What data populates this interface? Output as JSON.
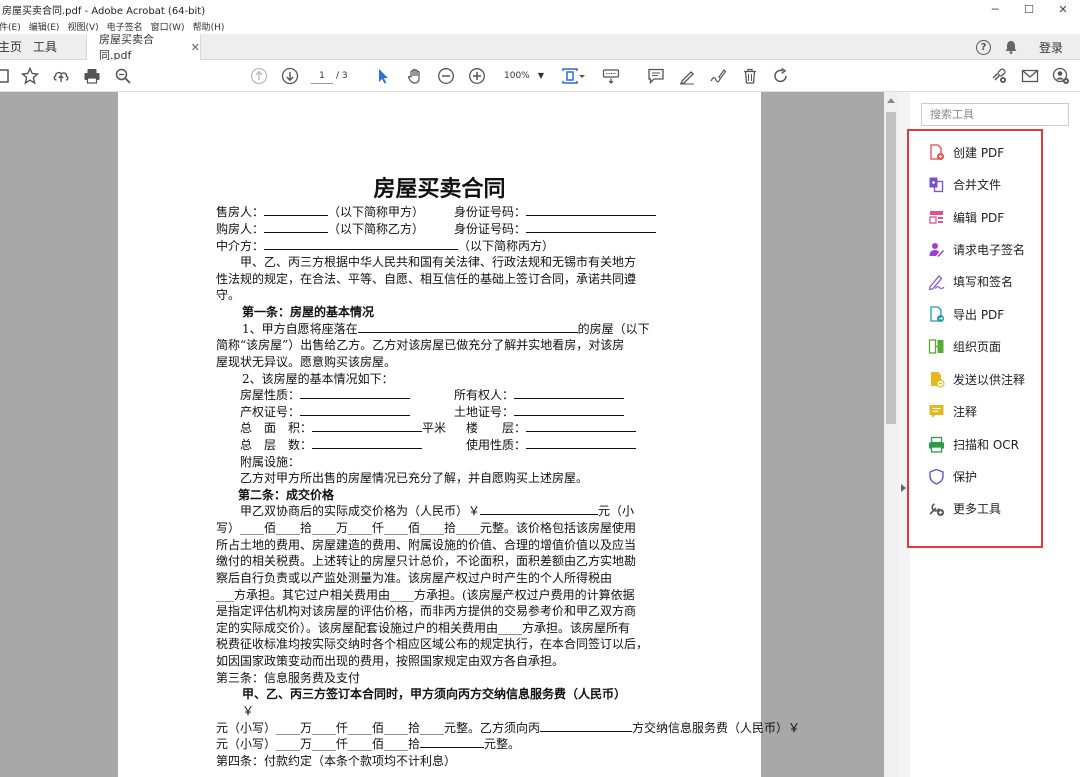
{
  "window": {
    "title": "房屋买卖合同.pdf - Adobe Acrobat (64-bit)",
    "min": "─",
    "max": "☐",
    "close": "✕"
  },
  "menu": [
    "件(E)",
    "编辑(E)",
    "视图(V)",
    "电子签名",
    "窗口(W)",
    "帮助(H)"
  ],
  "tabs": {
    "home": "主页",
    "tools": "工具",
    "doc": "房屋买卖合同.pdf",
    "login": "登录"
  },
  "toolbar": {
    "page_current": "1",
    "page_total": "/ 3",
    "zoom": "100%"
  },
  "document": {
    "title": "房屋买卖合同",
    "lines": [
      "售房人：",
      "（以下简称甲方）",
      "身份证号码：",
      "购房人：",
      "（以下简称乙方）",
      "身份证号码：",
      "中介方：",
      "（以下简称丙方）",
      "甲、乙、丙三方根据中华人民共和国有关法律、行政法规和无锡市有关地方",
      "性法规的规定，在合法、平等、自愿、相互信任的基础上签订合同，承诺共同遵",
      "守。",
      "第一条：房屋的基本情况",
      "1、甲方自愿将座落在",
      "的房屋（以下",
      "简称“该房屋”）出售给乙方。乙方对该房屋已做充分了解并实地看房，对该房",
      "屋现状无异议。愿意购买该房屋。",
      "2、该房屋的基本情况如下：",
      "房屋性质：",
      "所有权人：",
      "产权证号：",
      "土地证号：",
      "总　面　积：",
      "平米",
      "楼　　层：",
      "总　层　数：",
      "使用性质：",
      "附属设施：",
      "乙方对甲方所出售的房屋情况已充分了解，并自愿购买上述房屋。",
      "第二条：成交价格",
      "甲乙双协商后的实际成交价格为（人民币）￥",
      "元（小",
      "写）____佰____拾____万____仟____佰____拾____元整。该价格包括该房屋使用",
      "所占土地的费用、房屋建造的费用、附属设施的价值、合理的增值价值以及应当",
      "缴付的相关税费。上述转让的房屋只计总价，不论面积，面积差额由乙方实地勘",
      "察后自行负责或以产监处测量为准。该房屋产权过户时产生的个人所得税由",
      "___方承担。其它过户相关费用由____方承担。(该房屋产权过户费用的计算依据",
      "是指定评估机构对该房屋的评估价格，而非丙方提供的交易参考价和甲乙双方商",
      "定的实际成交价）。该房屋配套设施过户的相关费用由____方承担。该房屋所有",
      "税费征收标准均按实际交纳时各个相应区域公布的规定执行，在本合同签订以后，",
      "如因国家政策变动而出现的费用，按照国家规定由双方各自承担。",
      "第三条：信息服务费及支付",
      "甲、乙、丙三方签订本合同时，甲方须向丙方交纳信息服务费（人民币）",
      "￥",
      "元（小写）____万____仟____佰____拾____元整。乙方须向丙",
      "方交纳信息服务费（人民币）￥",
      "元（小写）____万____仟____佰____拾",
      "元整。",
      "第四条：付款约定（本条个款项均不计利息）"
    ]
  },
  "panel": {
    "search_placeholder": "搜索工具",
    "tools": [
      {
        "label": "创建 PDF",
        "icon": "create-pdf-icon",
        "color": "#e34850"
      },
      {
        "label": "合并文件",
        "icon": "combine-files-icon",
        "color": "#7a4fd6"
      },
      {
        "label": "编辑 PDF",
        "icon": "edit-pdf-icon",
        "color": "#e34f8d"
      },
      {
        "label": "请求电子签名",
        "icon": "request-signature-icon",
        "color": "#9f3fd0"
      },
      {
        "label": "填写和签名",
        "icon": "fill-sign-icon",
        "color": "#8a5bd6"
      },
      {
        "label": "导出 PDF",
        "icon": "export-pdf-icon",
        "color": "#1f9aa7"
      },
      {
        "label": "组织页面",
        "icon": "organize-pages-icon",
        "color": "#5aa83a"
      },
      {
        "label": "发送以供注释",
        "icon": "send-comments-icon",
        "color": "#e6b81e"
      },
      {
        "label": "注释",
        "icon": "comment-icon",
        "color": "#e6b81e"
      },
      {
        "label": "扫描和 OCR",
        "icon": "scan-ocr-icon",
        "color": "#2f9a4a"
      },
      {
        "label": "保护",
        "icon": "protect-icon",
        "color": "#5b5bd6"
      },
      {
        "label": "更多工具",
        "icon": "more-tools-icon",
        "color": "#555555"
      }
    ]
  }
}
